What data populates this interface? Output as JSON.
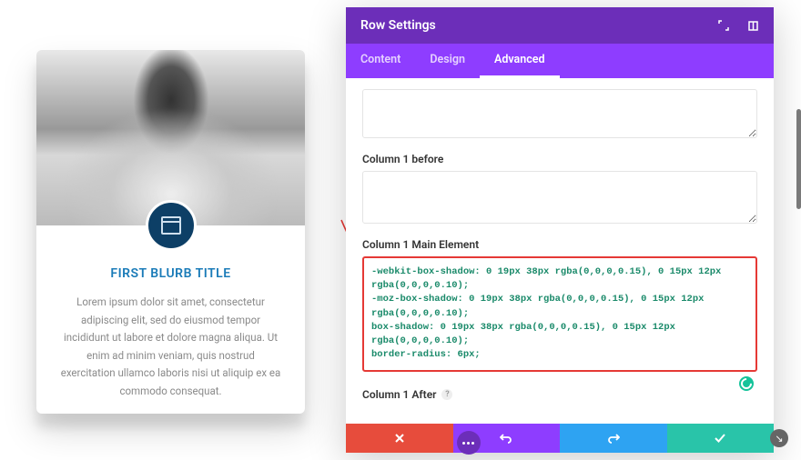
{
  "card": {
    "title": "FIRST BLURB TITLE",
    "text": "Lorem ipsum dolor sit amet, consectetur adipiscing elit, sed do eiusmod tempor incididunt ut labore et dolore magna aliqua. Ut enim ad minim veniam, quis nostrud exercitation ullamco laboris nisi ut aliquip ex ea commodo consequat.",
    "icon_name": "window-icon"
  },
  "panel": {
    "title": "Row Settings",
    "tabs": [
      {
        "label": "Content",
        "active": false
      },
      {
        "label": "Design",
        "active": false
      },
      {
        "label": "Advanced",
        "active": true
      }
    ],
    "fields": {
      "before": {
        "label": "Column 1 before",
        "value": ""
      },
      "main": {
        "label": "Column 1 Main Element",
        "value": "-webkit-box-shadow: 0 19px 38px rgba(0,0,0,0.15), 0 15px 12px rgba(0,0,0,0.10);\n-moz-box-shadow: 0 19px 38px rgba(0,0,0,0.15), 0 15px 12px rgba(0,0,0,0.10);\nbox-shadow: 0 19px 38px rgba(0,0,0,0.15), 0 15px 12px rgba(0,0,0,0.10);\nborder-radius: 6px;"
      },
      "after": {
        "label": "Column 1 After",
        "value": ""
      }
    },
    "footer_actions": [
      "cancel",
      "undo",
      "redo",
      "save"
    ]
  },
  "colors": {
    "accent_purple": "#8e3dff",
    "header_purple": "#6c2eb9",
    "danger": "#e74c3c",
    "info": "#2ea3f2",
    "success": "#29c4a9",
    "card_icon_bg": "#0d3f66",
    "highlight_border": "#e53935"
  }
}
